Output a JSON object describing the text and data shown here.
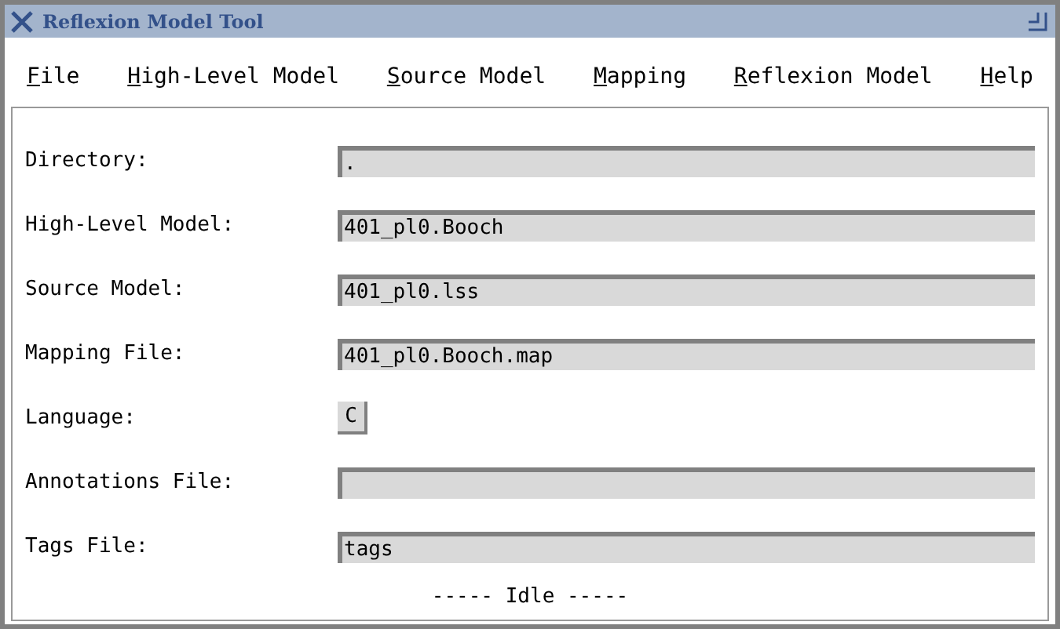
{
  "window": {
    "title": "Reflexion Model Tool"
  },
  "menu": [
    "File",
    "High-Level Model",
    "Source Model",
    "Mapping",
    "Reflexion Model",
    "Help"
  ],
  "form": [
    {
      "label": "Directory:",
      "kind": "field",
      "value": "."
    },
    {
      "label": "High-Level Model:",
      "kind": "field",
      "value": "401_pl0.Booch"
    },
    {
      "label": "Source Model:",
      "kind": "field",
      "value": "401_pl0.lss"
    },
    {
      "label": "Mapping File:",
      "kind": "field",
      "value": "401_pl0.Booch.map"
    },
    {
      "label": "Language:",
      "kind": "button",
      "value": "C"
    },
    {
      "label": "Annotations File:",
      "kind": "field"
    },
    {
      "label": "Tags File:",
      "kind": "field",
      "value": "tags"
    }
  ],
  "status": "----- Idle -----"
}
